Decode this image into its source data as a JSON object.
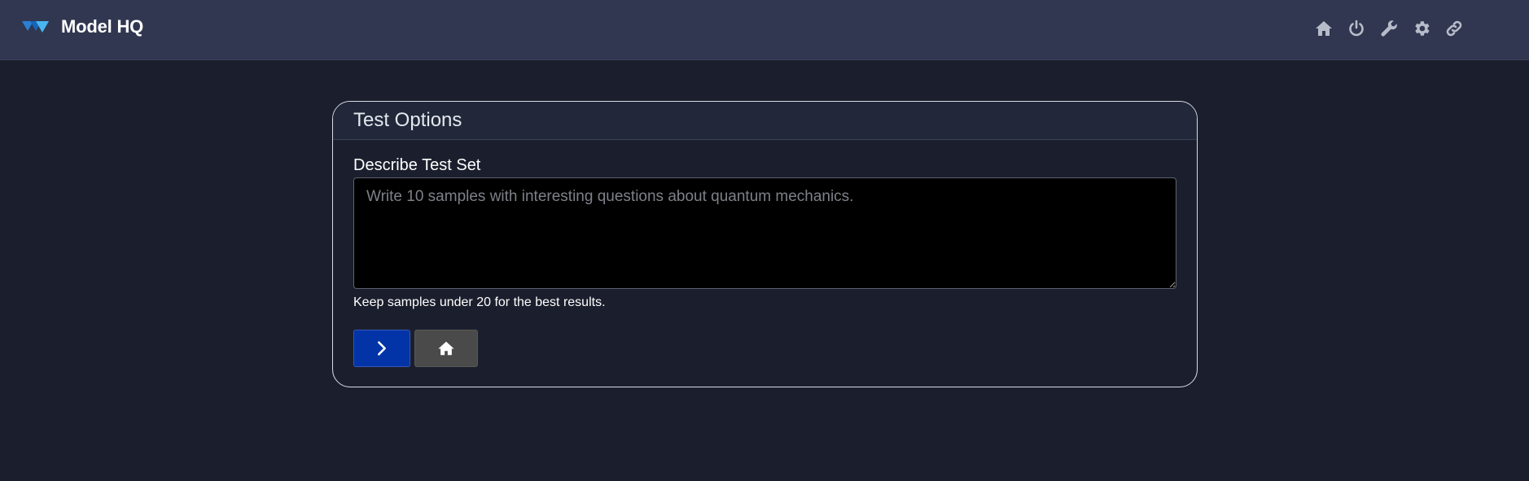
{
  "app": {
    "name": "Model HQ",
    "logo_colors": [
      "#2a7fd4",
      "#48b5f0"
    ]
  },
  "navbar": {
    "icons": [
      "home-icon",
      "power-icon",
      "wrench-icon",
      "gear-icon",
      "link-icon"
    ],
    "icon_color": "#b7bcc9",
    "background": "#313751"
  },
  "card": {
    "title": "Test Options",
    "field_label": "Describe Test Set",
    "textarea": {
      "value": "",
      "placeholder": "Write 10 samples with interesting questions about quantum mechanics."
    },
    "help_text": "Keep samples under 20 for the best results.",
    "buttons": [
      {
        "name": "next-button",
        "icon": "chevron-right-icon",
        "color": "#0234a8"
      },
      {
        "name": "home-button",
        "icon": "home-icon",
        "color": "#4a4a4a"
      }
    ]
  }
}
